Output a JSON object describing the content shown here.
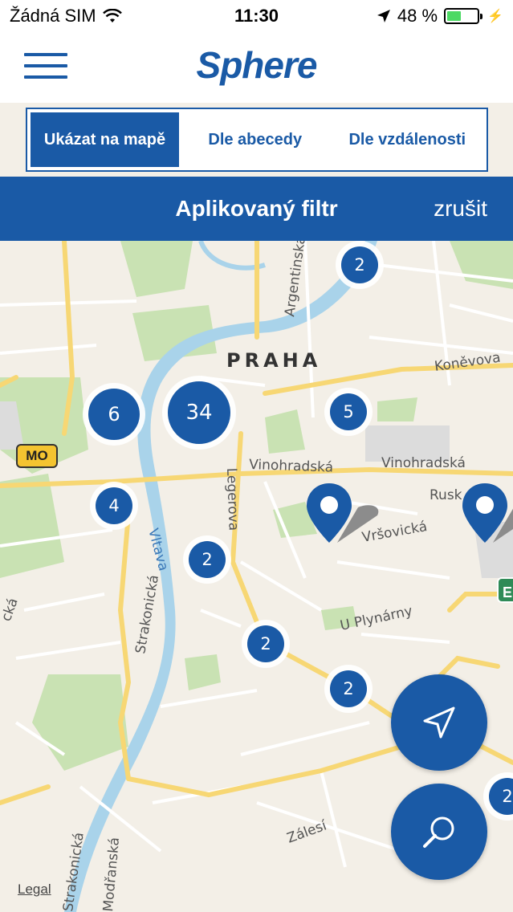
{
  "status_bar": {
    "carrier": "Žádná SIM",
    "time": "11:30",
    "battery_percent": "48 %",
    "battery_level": 0.48,
    "wifi_icon": "wifi-icon",
    "location_icon": "location-arrow-icon",
    "charging_icon": "bolt-icon"
  },
  "header": {
    "logo_text": "Sphere",
    "menu_icon": "hamburger-icon"
  },
  "view_tabs": [
    {
      "label": "Ukázat na mapě",
      "active": true
    },
    {
      "label": "Dle abecedy",
      "active": false
    },
    {
      "label": "Dle vzdálenosti",
      "active": false
    }
  ],
  "filter": {
    "title": "Aplikovaný filtr",
    "cancel_label": "zrušit"
  },
  "map": {
    "city_label": "PRAHA",
    "street_labels": [
      "Argentinská",
      "Koněvova",
      "Vinohradská",
      "Vinohradská",
      "Legerova",
      "Vltava",
      "Vršovická",
      "Rusk",
      "U Plynárny",
      "Strakonická",
      "Strakonická",
      "Zálesí",
      "Modřanská",
      "cká"
    ],
    "badge_mo": "MO",
    "badge_e": "E",
    "legal_label": "Legal",
    "clusters": [
      "2",
      "6",
      "34",
      "5",
      "4",
      "2",
      "2",
      "2",
      "2"
    ]
  },
  "colors": {
    "brand_blue": "#1a5aa6",
    "battery_green": "#4cd964"
  },
  "buttons": {
    "locate_icon": "navigation-arrow-icon",
    "search_icon": "search-icon"
  }
}
